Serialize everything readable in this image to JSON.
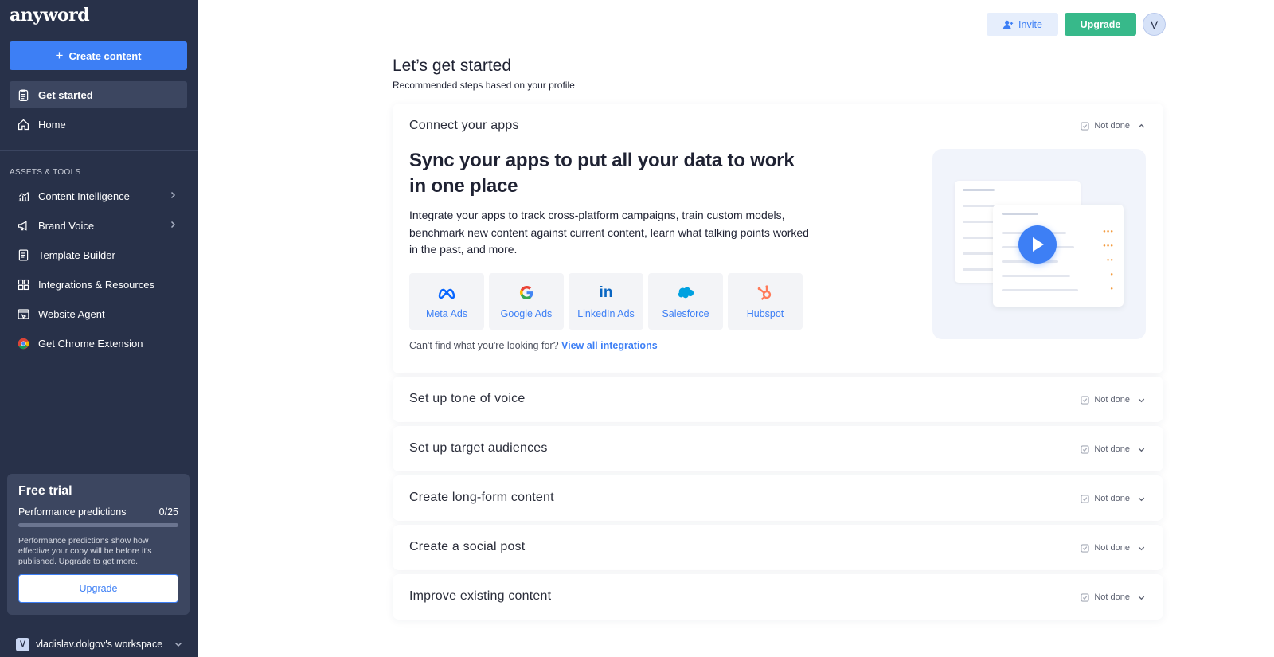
{
  "sidebar": {
    "logo": "anyword",
    "create_button": "Create content",
    "nav_top": [
      {
        "label": "Get started",
        "icon": "clipboard-list-icon",
        "active": true
      },
      {
        "label": "Home",
        "icon": "home-icon"
      }
    ],
    "section_label": "ASSETS & TOOLS",
    "nav_tools": [
      {
        "label": "Content Intelligence",
        "icon": "bar-chart-icon",
        "chevron": true
      },
      {
        "label": "Brand Voice",
        "icon": "megaphone-icon",
        "chevron": true
      },
      {
        "label": "Template Builder",
        "icon": "document-icon"
      },
      {
        "label": "Integrations & Resources",
        "icon": "grid-icon"
      },
      {
        "label": "Website Agent",
        "icon": "browser-icon"
      },
      {
        "label": "Get Chrome Extension",
        "icon": "chrome-icon"
      }
    ],
    "trial": {
      "title": "Free trial",
      "metric_label": "Performance predictions",
      "metric_value": "0/25",
      "progress_fraction": 0,
      "description": "Performance predictions show how effective your copy will be before it's published. Upgrade to get more.",
      "upgrade_label": "Upgrade"
    },
    "workspace": {
      "initial": "V",
      "name": "vladislav.dolgov's workspace"
    }
  },
  "topbar": {
    "invite_label": "Invite",
    "upgrade_label": "Upgrade",
    "avatar_initial": "V"
  },
  "main": {
    "title": "Let’s get started",
    "subtitle": "Recommended steps based on your profile",
    "expanded_step": {
      "title": "Connect your apps",
      "status": "Not done",
      "headline": "Sync your apps to put all your data to work in one place",
      "body": "Integrate your apps to track cross-platform campaigns, train custom models, benchmark new content against current content, learn what talking points worked in the past, and more.",
      "integrations": [
        {
          "label": "Meta Ads",
          "icon": "meta-icon"
        },
        {
          "label": "Google Ads",
          "icon": "google-icon"
        },
        {
          "label": "LinkedIn Ads",
          "icon": "linkedin-icon"
        },
        {
          "label": "Salesforce",
          "icon": "salesforce-icon"
        },
        {
          "label": "Hubspot",
          "icon": "hubspot-icon"
        }
      ],
      "cant_find": "Can't find what you're looking for?",
      "view_all": "View all integrations"
    },
    "collapsed_steps": [
      {
        "title": "Set up tone of voice",
        "status": "Not done"
      },
      {
        "title": "Set up target audiences",
        "status": "Not done"
      },
      {
        "title": "Create long-form content",
        "status": "Not done"
      },
      {
        "title": "Create a social post",
        "status": "Not done"
      },
      {
        "title": "Improve existing content",
        "status": "Not done"
      }
    ]
  },
  "colors": {
    "sidebar_bg": "#283149",
    "accent_blue": "#3d7ff5",
    "upgrade_green": "#37b98a"
  }
}
